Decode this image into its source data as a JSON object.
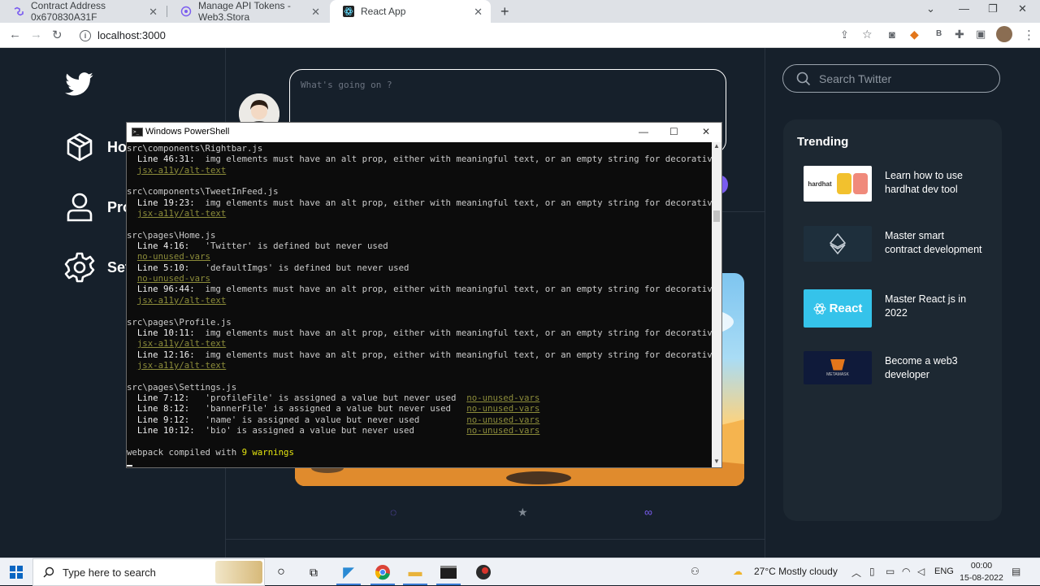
{
  "browser": {
    "tabs": [
      {
        "title": "Contract Address 0x670830A31F",
        "active": false
      },
      {
        "title": "Manage API Tokens - Web3.Stora",
        "active": false
      },
      {
        "title": "React App",
        "active": true
      }
    ],
    "new_tab_symbol": "+",
    "url": "localhost:3000"
  },
  "app": {
    "nav": [
      {
        "label": "Home",
        "icon": "cube-icon"
      },
      {
        "label": "Profile",
        "icon": "user-icon"
      },
      {
        "label": "Settings",
        "icon": "gear-icon"
      }
    ],
    "composer_placeholder": "What's going on ?",
    "search_placeholder": "Search Twitter",
    "trending_title": "Trending",
    "trending": [
      {
        "text": "Learn how to use hardhat dev tool",
        "thumb": "hardhat"
      },
      {
        "text": "Master smart contract development",
        "thumb": "contract"
      },
      {
        "text": "Master React js in 2022",
        "thumb": "React"
      },
      {
        "text": "Become a web3 developer",
        "thumb": "METAMASK"
      }
    ]
  },
  "powershell": {
    "title": "Windows PowerShell",
    "lines": [
      {
        "segs": [
          {
            "t": "src\\components\\Rightbar.js",
            "c": ""
          }
        ]
      },
      {
        "segs": [
          {
            "t": "  Line 46:31:  ",
            "c": "b"
          },
          {
            "t": "img elements must have an alt prop, either with meaningful text, or an empty string for decorative images",
            "c": ""
          }
        ]
      },
      {
        "segs": [
          {
            "t": "  ",
            "c": ""
          },
          {
            "t": "jsx-a11y/alt-text",
            "c": "u"
          }
        ]
      },
      {
        "segs": [
          {
            "t": "",
            "c": ""
          }
        ]
      },
      {
        "segs": [
          {
            "t": "src\\components\\TweetInFeed.js",
            "c": ""
          }
        ]
      },
      {
        "segs": [
          {
            "t": "  Line 19:23:  ",
            "c": "b"
          },
          {
            "t": "img elements must have an alt prop, either with meaningful text, or an empty string for decorative images",
            "c": ""
          }
        ]
      },
      {
        "segs": [
          {
            "t": "  ",
            "c": ""
          },
          {
            "t": "jsx-a11y/alt-text",
            "c": "u"
          }
        ]
      },
      {
        "segs": [
          {
            "t": "",
            "c": ""
          }
        ]
      },
      {
        "segs": [
          {
            "t": "src\\pages\\Home.js",
            "c": ""
          }
        ]
      },
      {
        "segs": [
          {
            "t": "  Line 4:16:   ",
            "c": "b"
          },
          {
            "t": "'Twitter' is defined but never used",
            "c": ""
          }
        ]
      },
      {
        "segs": [
          {
            "t": "  ",
            "c": ""
          },
          {
            "t": "no-unused-vars",
            "c": "u"
          }
        ]
      },
      {
        "segs": [
          {
            "t": "  Line 5:10:   ",
            "c": "b"
          },
          {
            "t": "'defaultImgs' is defined but never used",
            "c": ""
          }
        ]
      },
      {
        "segs": [
          {
            "t": "  ",
            "c": ""
          },
          {
            "t": "no-unused-vars",
            "c": "u"
          }
        ]
      },
      {
        "segs": [
          {
            "t": "  Line 96:44:  ",
            "c": "b"
          },
          {
            "t": "img elements must have an alt prop, either with meaningful text, or an empty string for decorative images",
            "c": ""
          }
        ]
      },
      {
        "segs": [
          {
            "t": "  ",
            "c": ""
          },
          {
            "t": "jsx-a11y/alt-text",
            "c": "u"
          }
        ]
      },
      {
        "segs": [
          {
            "t": "",
            "c": ""
          }
        ]
      },
      {
        "segs": [
          {
            "t": "src\\pages\\Profile.js",
            "c": ""
          }
        ]
      },
      {
        "segs": [
          {
            "t": "  Line 10:11:  ",
            "c": "b"
          },
          {
            "t": "img elements must have an alt prop, either with meaningful text, or an empty string for decorative images",
            "c": ""
          }
        ]
      },
      {
        "segs": [
          {
            "t": "  ",
            "c": ""
          },
          {
            "t": "jsx-a11y/alt-text",
            "c": "u"
          }
        ]
      },
      {
        "segs": [
          {
            "t": "  Line 12:16:  ",
            "c": "b"
          },
          {
            "t": "img elements must have an alt prop, either with meaningful text, or an empty string for decorative images",
            "c": ""
          }
        ]
      },
      {
        "segs": [
          {
            "t": "  ",
            "c": ""
          },
          {
            "t": "jsx-a11y/alt-text",
            "c": "u"
          }
        ]
      },
      {
        "segs": [
          {
            "t": "",
            "c": ""
          }
        ]
      },
      {
        "segs": [
          {
            "t": "src\\pages\\Settings.js",
            "c": ""
          }
        ]
      },
      {
        "segs": [
          {
            "t": "  Line 7:12:   ",
            "c": "b"
          },
          {
            "t": "'profileFile' is assigned a value but never used  ",
            "c": ""
          },
          {
            "t": "no-unused-vars",
            "c": "u"
          }
        ]
      },
      {
        "segs": [
          {
            "t": "  Line 8:12:   ",
            "c": "b"
          },
          {
            "t": "'bannerFile' is assigned a value but never used   ",
            "c": ""
          },
          {
            "t": "no-unused-vars",
            "c": "u"
          }
        ]
      },
      {
        "segs": [
          {
            "t": "  Line 9:12:   ",
            "c": "b"
          },
          {
            "t": "'name' is assigned a value but never used         ",
            "c": ""
          },
          {
            "t": "no-unused-vars",
            "c": "u"
          }
        ]
      },
      {
        "segs": [
          {
            "t": "  Line 10:12:  ",
            "c": "b"
          },
          {
            "t": "'bio' is assigned a value but never used          ",
            "c": ""
          },
          {
            "t": "no-unused-vars",
            "c": "u"
          }
        ]
      },
      {
        "segs": [
          {
            "t": "",
            "c": ""
          }
        ]
      },
      {
        "segs": [
          {
            "t": "webpack compiled with ",
            "c": ""
          },
          {
            "t": "9 warnings",
            "c": "y"
          }
        ]
      }
    ]
  },
  "taskbar": {
    "search_placeholder": "Type here to search",
    "weather": "27°C  Mostly cloudy",
    "language": "ENG",
    "time": "00:00",
    "date": "15-08-2022"
  },
  "colors": {
    "app_bg": "#16202b",
    "panel_bg": "#1d2832",
    "accent_purple": "#7a5cf0",
    "terminal_bg": "#0c0c0c"
  }
}
